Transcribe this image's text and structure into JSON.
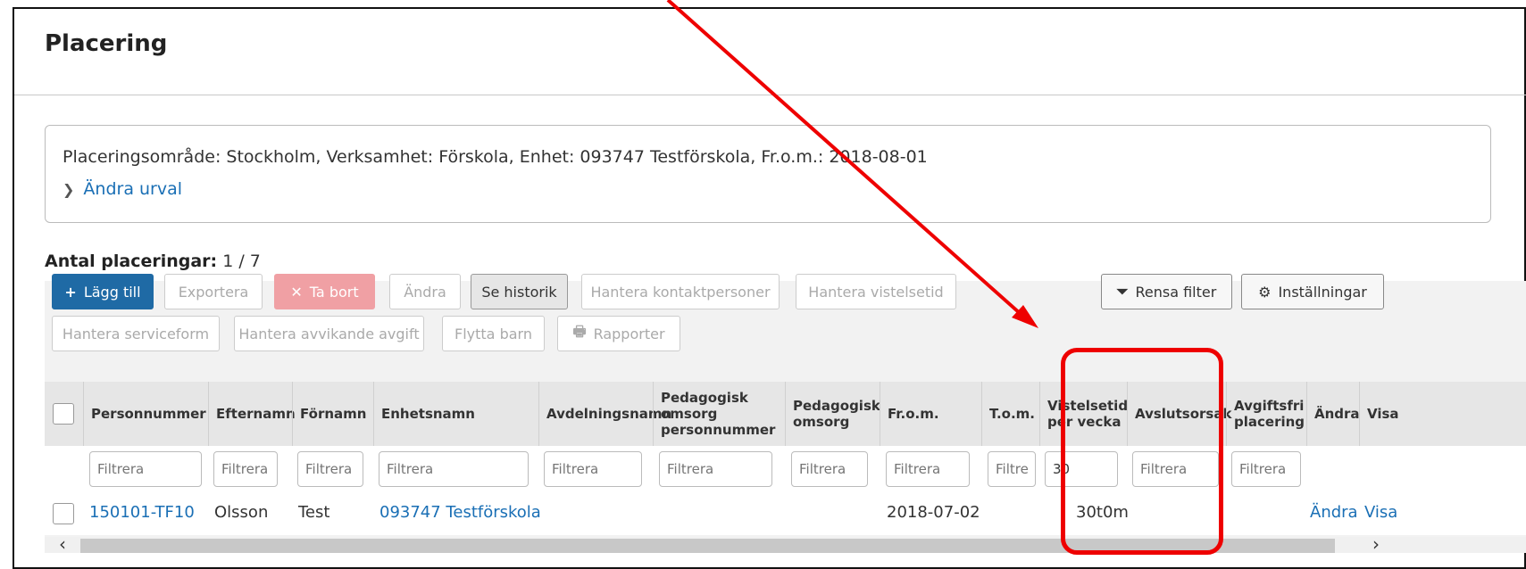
{
  "page": {
    "title": "Placering"
  },
  "selection": {
    "summary": "Placeringsområde: Stockholm, Verksamhet: Förskola, Enhet: 093747 Testförskola, Fr.o.m.: 2018-08-01",
    "change_link": "Ändra urval"
  },
  "count": {
    "label": "Antal placeringar:",
    "value": "1 / 7"
  },
  "toolbar": {
    "add": "Lägg till",
    "export": "Exportera",
    "delete": "Ta bort",
    "edit": "Ändra",
    "history": "Se historik",
    "contacts": "Hantera kontaktpersoner",
    "stay_time": "Hantera vistelsetid",
    "clear_filter": "Rensa filter",
    "settings": "Inställningar",
    "service_form": "Hantera serviceform",
    "deviating_fee": "Hantera avvikande avgift",
    "move_child": "Flytta barn",
    "reports": "Rapporter"
  },
  "table": {
    "headers": {
      "personnummer": "Personnummer",
      "efternamn": "Efternamn",
      "fornamn": "Förnamn",
      "enhetsnamn": "Enhetsnamn",
      "avdelningsnamn": "Avdelningsnamn",
      "ped_pnr_1": "Pedagogisk",
      "ped_pnr_2": "omsorg",
      "ped_pnr_3": "personnummer",
      "ped_1": "Pedagogisk",
      "ped_2": "omsorg",
      "from": "Fr.o.m.",
      "tom": "T.o.m.",
      "vist_1": "Vistelsetid",
      "vist_2": "per vecka",
      "avslut": "Avslutsorsak",
      "avg_1": "Avgiftsfri",
      "avg_2": "placering",
      "andra": "Ändra",
      "visa": "Visa"
    },
    "filter_placeholder": "Filtrera",
    "filter_short": "Filtre",
    "vistelsetid_filter_value": "30",
    "row": {
      "personnummer": "150101-TF10",
      "efternamn": "Olsson",
      "fornamn": "Test",
      "enhetsnamn": "093747 Testförskola",
      "from": "2018-07-02",
      "vistelsetid": "30t0m",
      "andra": "Ändra",
      "visa": "Visa"
    }
  },
  "colors": {
    "primary": "#1f6aa5",
    "link": "#1a6fb5",
    "annotation": "#e00000"
  }
}
